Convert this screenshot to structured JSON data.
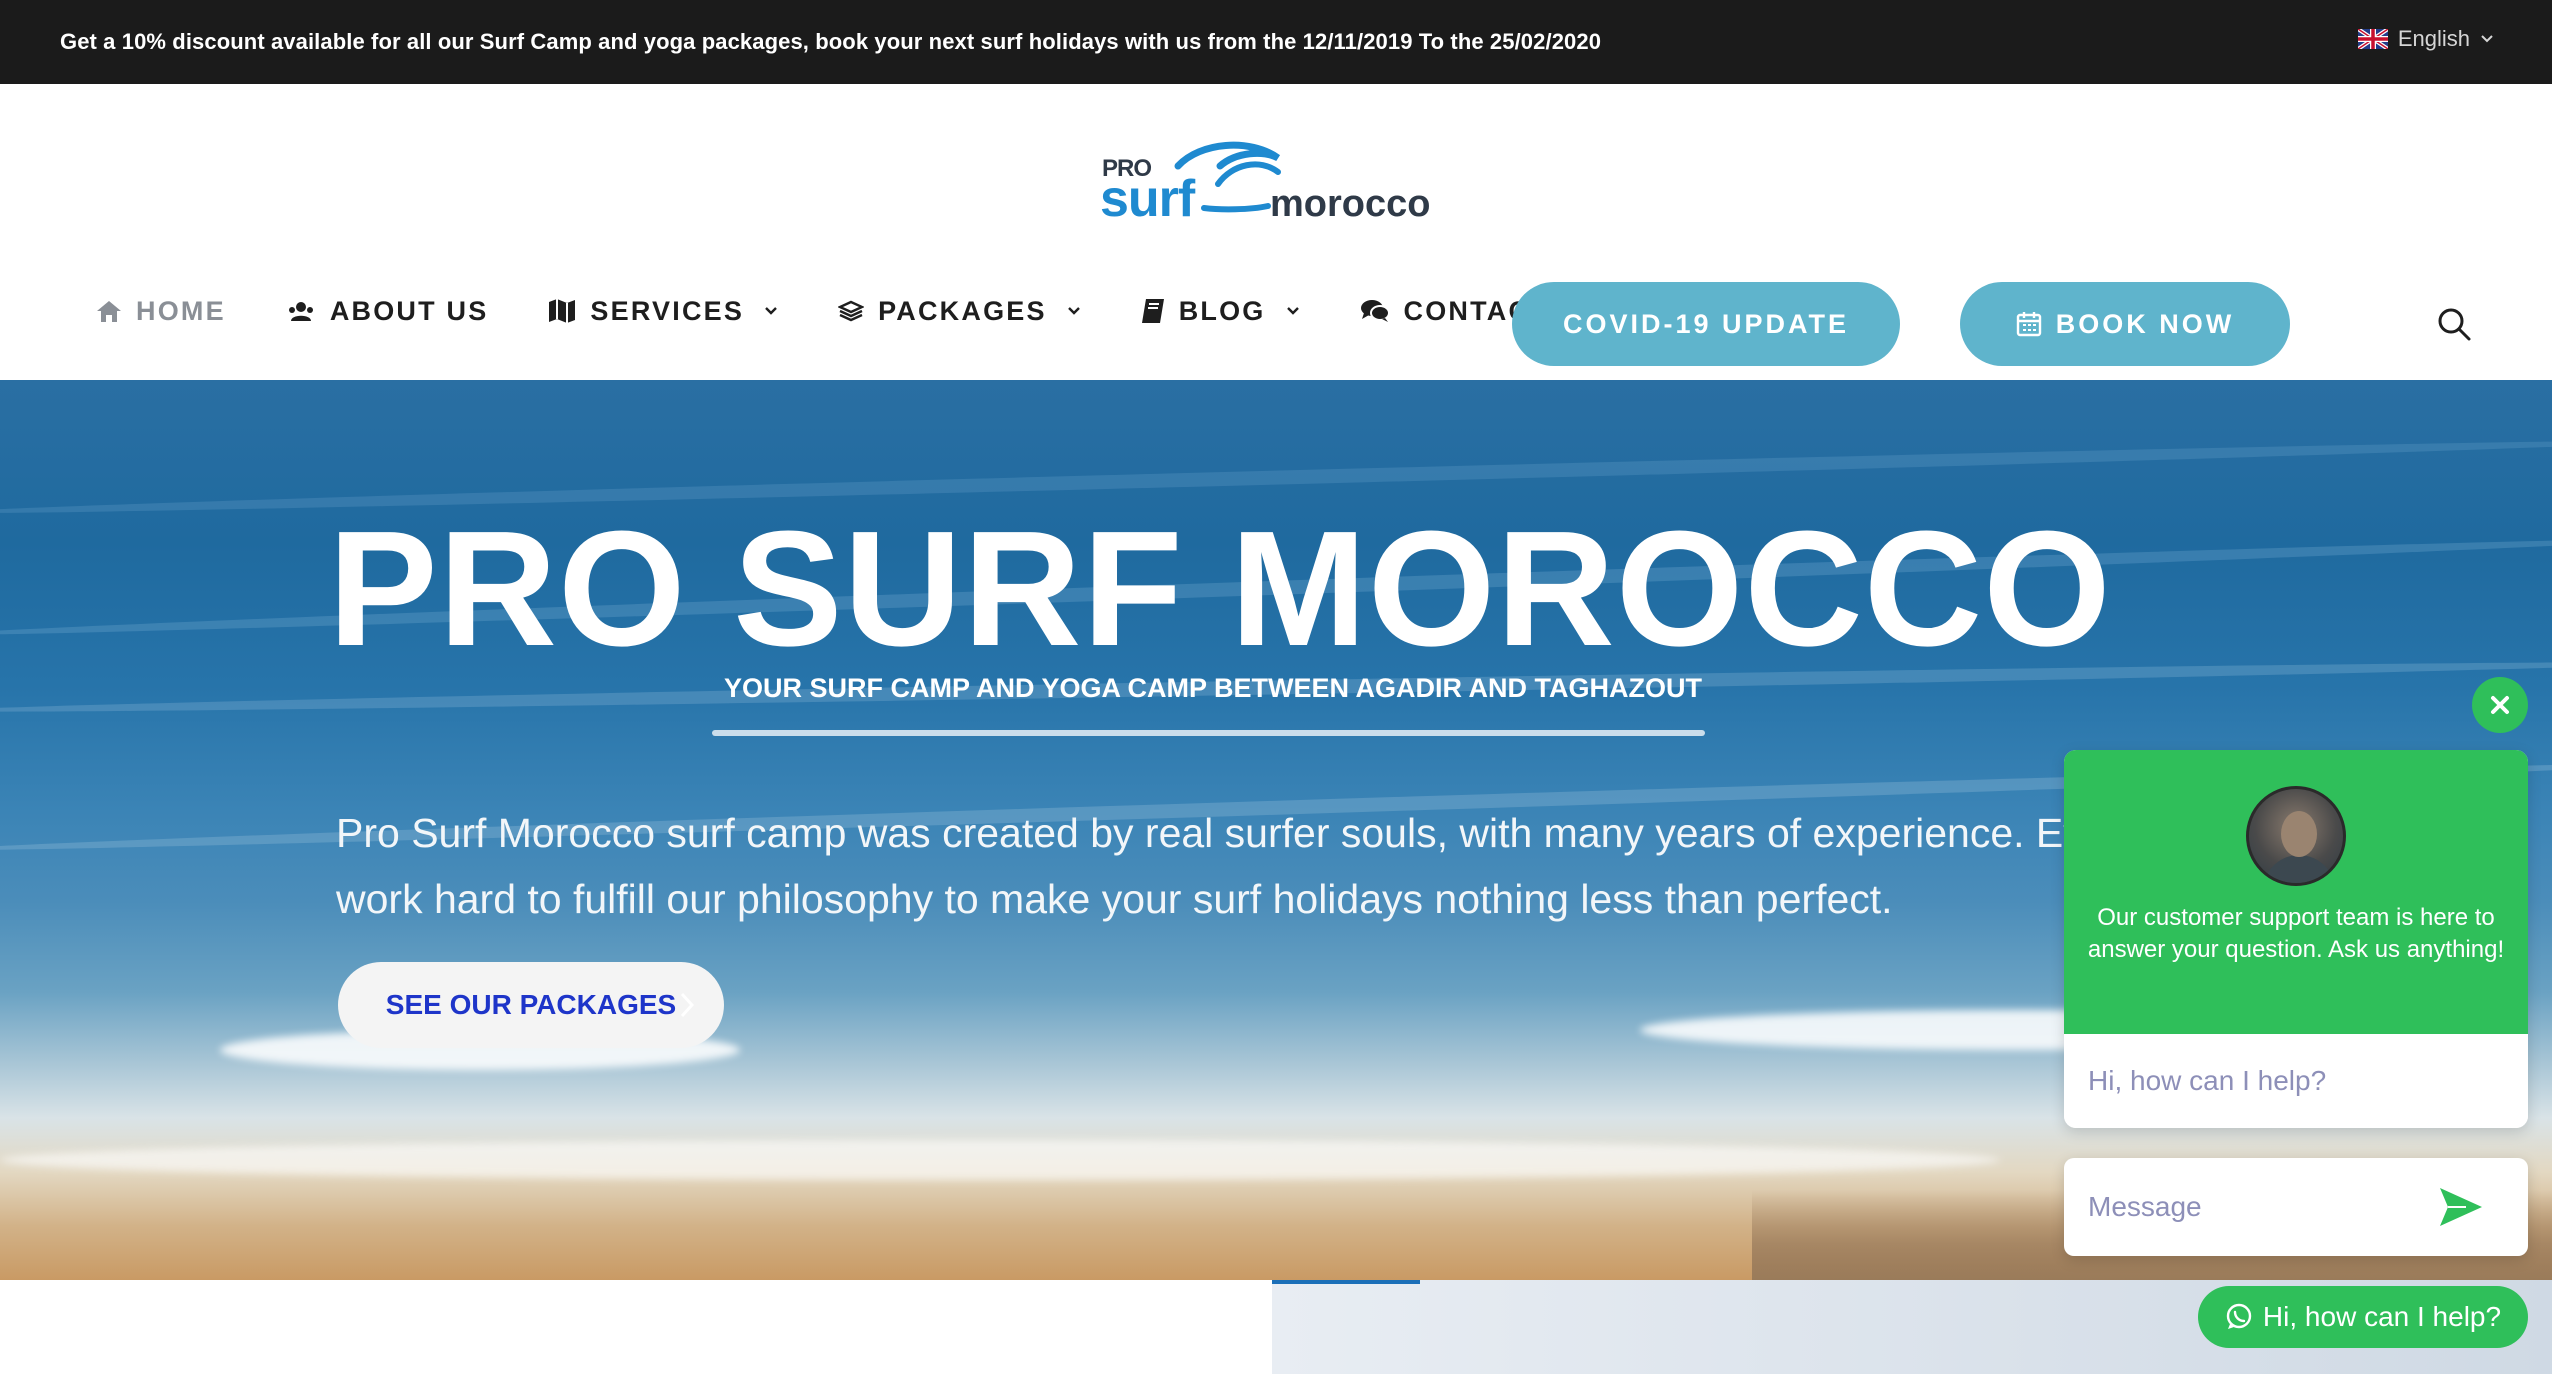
{
  "topbar": {
    "announcement": "Get a 10% discount available for all our Surf Camp and yoga packages, book your next surf holidays with us from the 12/11/2019 To the 25/02/2020",
    "language": "English"
  },
  "logo": {
    "pro": "PRO",
    "surf": "surf",
    "morocco": "morocco"
  },
  "nav": {
    "items": [
      {
        "label": "HOME",
        "icon": "home-icon"
      },
      {
        "label": "ABOUT US",
        "icon": "users-icon"
      },
      {
        "label": "SERVICES",
        "icon": "map-icon"
      },
      {
        "label": "PACKAGES",
        "icon": "layers-icon"
      },
      {
        "label": "BLOG",
        "icon": "book-icon"
      },
      {
        "label": "CONTACT US",
        "icon": "chat-icon"
      }
    ],
    "covid_button": "COVID-19 UPDATE",
    "book_button": "BOOK NOW"
  },
  "hero": {
    "title": "PRO SURF MOROCCO",
    "subtitle": "YOUR SURF CAMP AND YOGA CAMP BETWEEN AGADIR AND TAGHAZOUT",
    "description_line1": "Pro Surf Morocco surf camp was created by real surfer souls, with many years of experience. Every d",
    "description_line2": "work hard to fulfill our philosophy to make your surf holidays nothing less than perfect.",
    "cta_button": "SEE OUR PACKAGES"
  },
  "chat": {
    "support_message": "Our customer support team is here to answer your question. Ask us anything!",
    "greeting": "Hi, how can I help?",
    "message_placeholder": "Message",
    "whatsapp_button": "Hi, how can I help?"
  },
  "colors": {
    "topbar_bg": "#1b1b1b",
    "accent_teal": "#5fb4cc",
    "chat_green": "#2fbf5a",
    "cta_text_blue": "#1e35c9",
    "logo_blue": "#1f8ad0"
  }
}
